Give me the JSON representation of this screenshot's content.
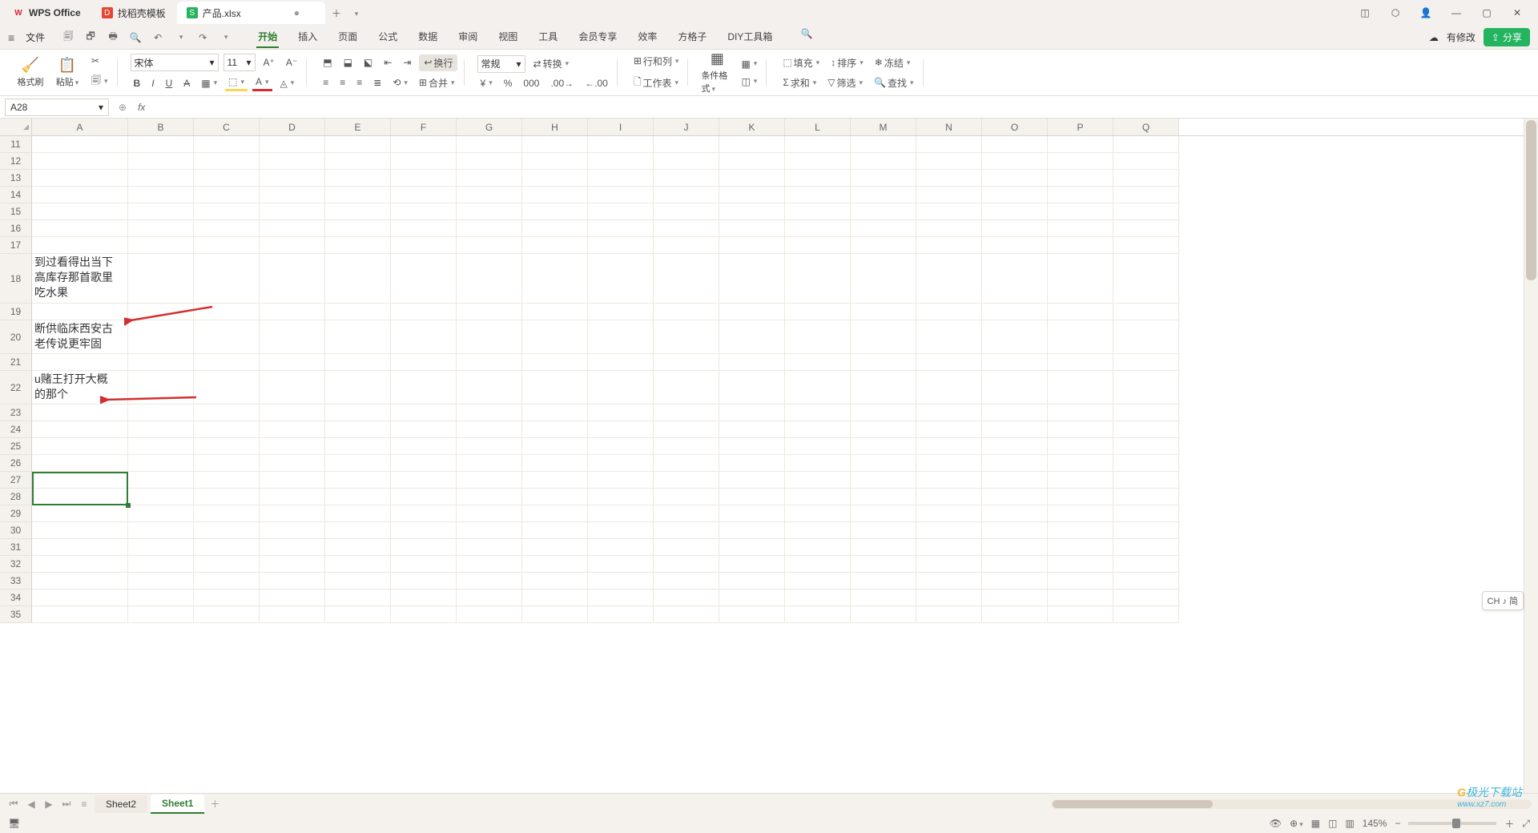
{
  "titlebar": {
    "app": "WPS Office",
    "tabs": [
      {
        "icon": "D",
        "label": "找稻壳模板"
      },
      {
        "icon": "S",
        "label": "产品.xlsx",
        "dirty": "●"
      }
    ]
  },
  "menubar": {
    "file": "文件",
    "items": [
      "开始",
      "插入",
      "页面",
      "公式",
      "数据",
      "审阅",
      "视图",
      "工具",
      "会员专享",
      "效率",
      "方格子",
      "DIY工具箱"
    ],
    "active": 0,
    "right": {
      "modify": "有修改",
      "share": "分享"
    }
  },
  "ribbon": {
    "format_brush": "格式刷",
    "paste": "粘贴",
    "font_name": "宋体",
    "font_size": "11",
    "wrap": "换行",
    "merge": "合并",
    "normal": "常规",
    "convert": "转换",
    "rowcol": "行和列",
    "worksheet": "工作表",
    "cond_format": "条件格式",
    "fill": "填充",
    "sort": "排序",
    "freeze": "冻结",
    "sum": "求和",
    "filter": "筛选",
    "find": "查找"
  },
  "formula": {
    "namebox": "A28",
    "fx": "fx",
    "value": ""
  },
  "columns": [
    "A",
    "B",
    "C",
    "D",
    "E",
    "F",
    "G",
    "H",
    "I",
    "J",
    "K",
    "L",
    "M",
    "N",
    "O",
    "P",
    "Q"
  ],
  "rows": [
    {
      "n": 11,
      "a": ""
    },
    {
      "n": 12,
      "a": ""
    },
    {
      "n": 13,
      "a": ""
    },
    {
      "n": 14,
      "a": ""
    },
    {
      "n": 15,
      "a": ""
    },
    {
      "n": 16,
      "a": ""
    },
    {
      "n": 17,
      "a": ""
    },
    {
      "n": 18,
      "a": "到过看得出当下\n高库存那首歌里\n吃水果",
      "tall": true
    },
    {
      "n": 19,
      "a": ""
    },
    {
      "n": 20,
      "a": "断供临床西安古\n老传说更牢固",
      "mid": true
    },
    {
      "n": 21,
      "a": ""
    },
    {
      "n": 22,
      "a": "u赌王打开大概\n的那个",
      "mid": true
    },
    {
      "n": 23,
      "a": ""
    },
    {
      "n": 24,
      "a": ""
    },
    {
      "n": 25,
      "a": ""
    },
    {
      "n": 26,
      "a": ""
    },
    {
      "n": 27,
      "a": ""
    },
    {
      "n": 28,
      "a": ""
    },
    {
      "n": 29,
      "a": ""
    },
    {
      "n": 30,
      "a": ""
    },
    {
      "n": 31,
      "a": ""
    },
    {
      "n": 32,
      "a": ""
    },
    {
      "n": 33,
      "a": ""
    },
    {
      "n": 34,
      "a": ""
    },
    {
      "n": 35,
      "a": ""
    }
  ],
  "selection": {
    "ref": "A27:A28"
  },
  "sheets": {
    "items": [
      "Sheet2",
      "Sheet1"
    ],
    "active": 1
  },
  "status": {
    "zoom": "145%",
    "ime": "CH ♪ 简"
  },
  "watermark": {
    "brand": "极光下载站",
    "url": "www.xz7.com"
  }
}
